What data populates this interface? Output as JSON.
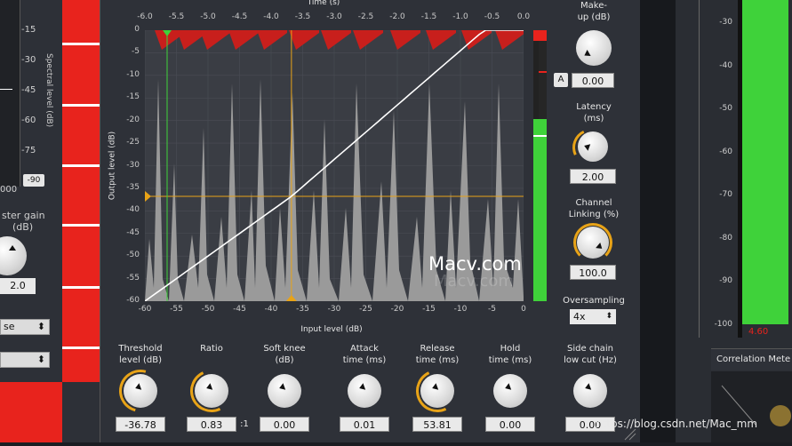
{
  "left_window": {
    "spectral_axis": {
      "ticks": [
        "-15",
        "-30",
        "-45",
        "-60",
        "-75"
      ],
      "label": "Spectral level (dB)",
      "box_value": "-90",
      "left_tick": "000"
    },
    "master_gain": {
      "label_line1": "ster gain",
      "label_line2": "(dB)",
      "value": "2.0"
    },
    "dropdown1": {
      "value": "se"
    },
    "dropdown2": {
      "value": ""
    }
  },
  "plugin": {
    "time_axis": {
      "label": "Time (s)",
      "ticks": [
        "-6.0",
        "-5.5",
        "-5.0",
        "-4.5",
        "-4.0",
        "-3.5",
        "-3.0",
        "-2.5",
        "-2.0",
        "-1.5",
        "-1.0",
        "-0.5",
        "0.0"
      ]
    },
    "output_axis": {
      "label": "Output level (dB)",
      "ticks": [
        "0",
        "-5",
        "-10",
        "-15",
        "-20",
        "-25",
        "-30",
        "-35",
        "-40",
        "-45",
        "-50",
        "-55",
        "-60"
      ]
    },
    "input_axis": {
      "label": "Input level (dB)",
      "ticks": [
        "-60",
        "-55",
        "-50",
        "-45",
        "-40",
        "-35",
        "-30",
        "-25",
        "-20",
        "-15",
        "-10",
        "-5",
        "0"
      ]
    },
    "threshold_db": -36.78,
    "makeup": {
      "label": "Make-\nup (dB)",
      "value": "0.00",
      "auto_label": "A"
    },
    "latency": {
      "label": "Latency\n(ms)",
      "value": "2.00"
    },
    "channel_linking": {
      "label": "Channel\nLinking (%)",
      "value": "100.0"
    },
    "oversampling": {
      "label": "Oversampling",
      "value": "4x"
    },
    "knobs": [
      {
        "id": "threshold",
        "label": "Threshold\nlevel (dB)",
        "value": "-36.78"
      },
      {
        "id": "ratio",
        "label": "Ratio",
        "value": "0.83",
        "suffix": ":1"
      },
      {
        "id": "soft-knee",
        "label": "Soft knee\n(dB)",
        "value": "0.00"
      },
      {
        "id": "attack",
        "label": "Attack\ntime (ms)",
        "value": "0.01"
      },
      {
        "id": "release",
        "label": "Release\ntime (ms)",
        "value": "53.81"
      },
      {
        "id": "hold",
        "label": "Hold\ntime (ms)",
        "value": "0.00"
      },
      {
        "id": "sidechain",
        "label": "Side chain\nlow cut (Hz)",
        "value": "0.00"
      }
    ]
  },
  "right_panel": {
    "ticks": [
      "-30",
      "-40",
      "-50",
      "-60",
      "-70",
      "-80",
      "-90",
      "-100"
    ],
    "meter_value": "4.60",
    "correlation_label": "Correlation Mete"
  },
  "watermark": {
    "text": "Macv.com",
    "ghost": "Macv.com"
  },
  "footer_link": "https://blog.csdn.net/Mac_mm",
  "colors": {
    "accent": "#e8a317",
    "meter_green": "#3fd23a",
    "red": "#e8231d",
    "waveform": "#9a9a9a"
  }
}
